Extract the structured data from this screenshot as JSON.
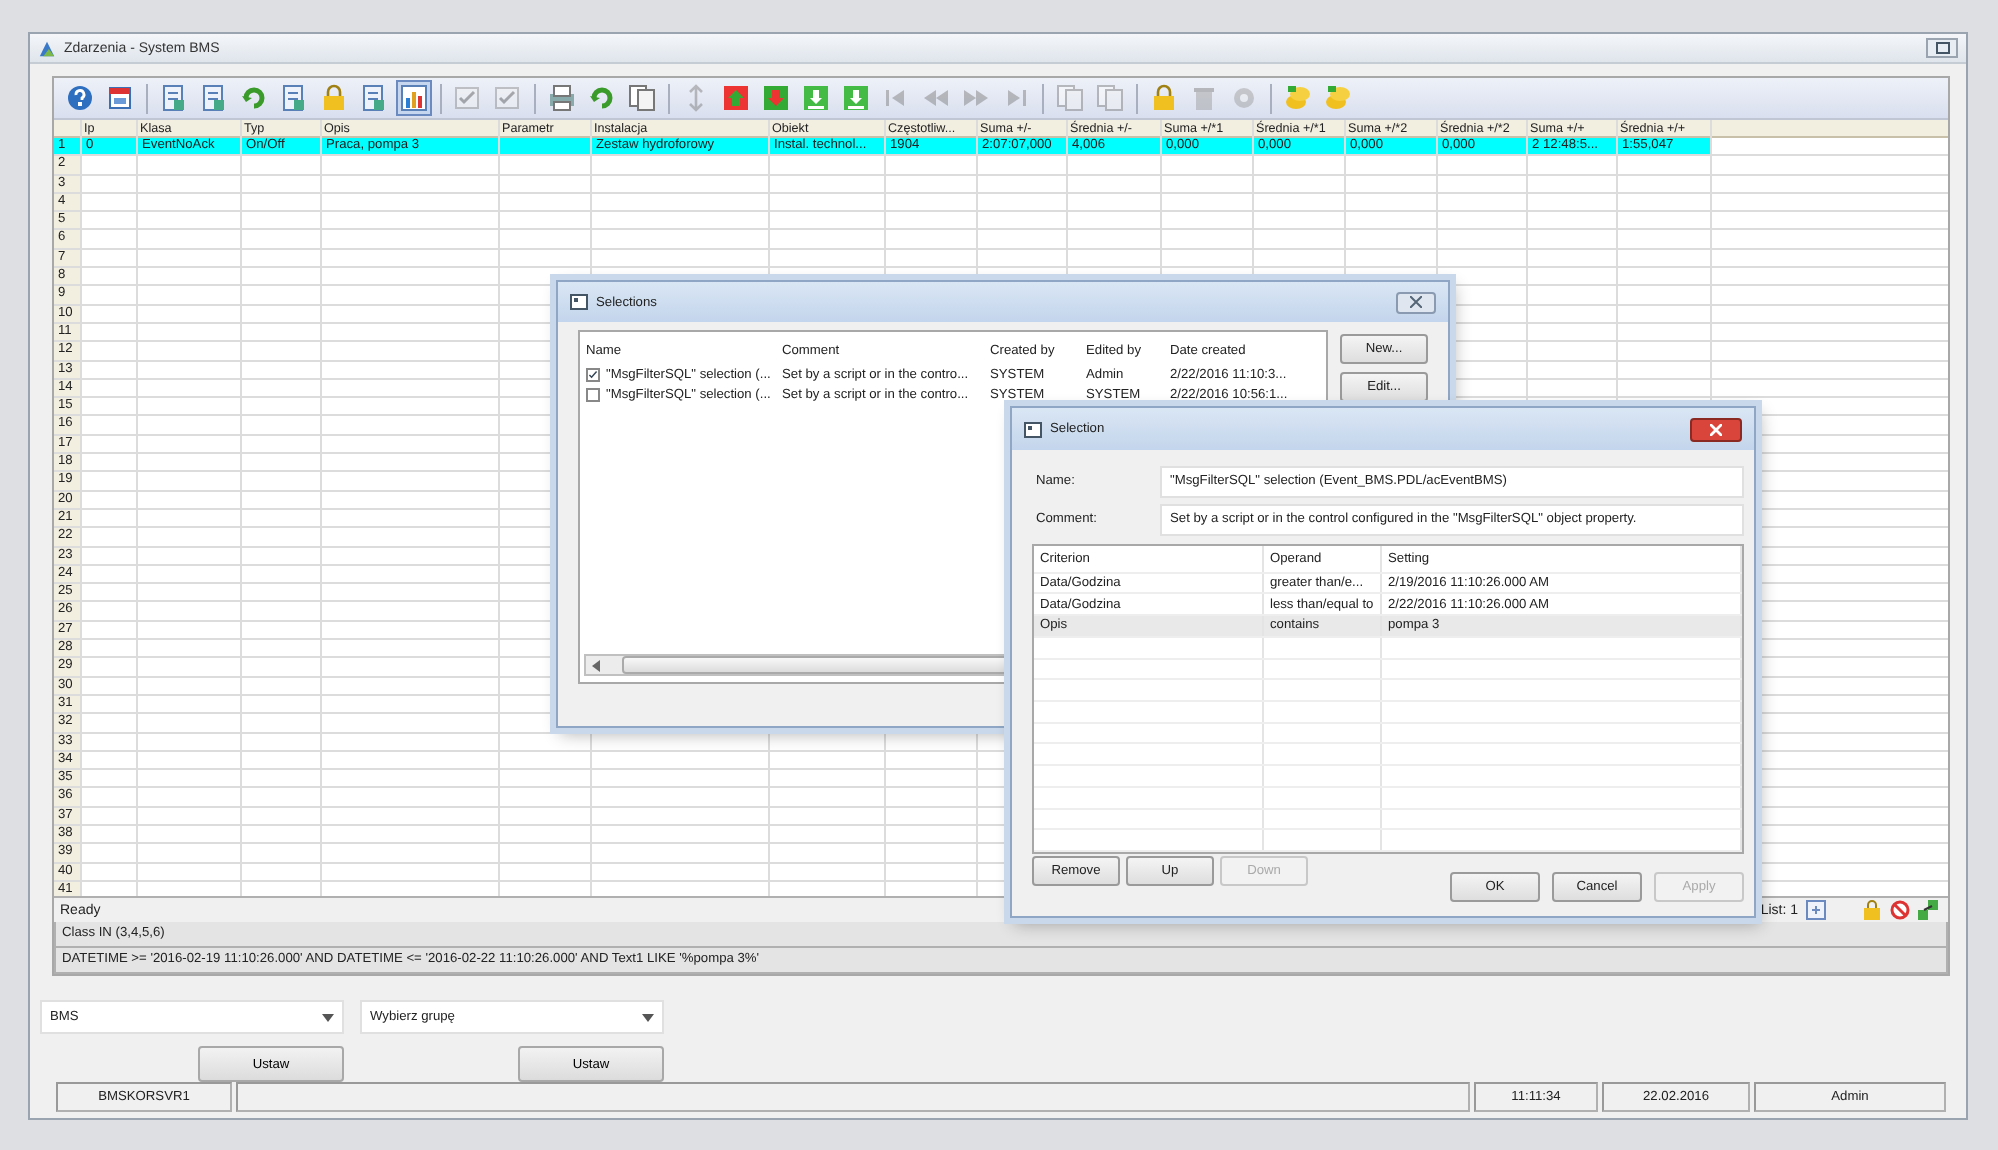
{
  "window": {
    "title": "Zdarzenia - System BMS"
  },
  "toolbar": [
    {
      "kind": "help",
      "disabled": false,
      "pressed": false
    },
    {
      "kind": "calendar",
      "disabled": false,
      "pressed": false
    },
    {
      "kind": "separator"
    },
    {
      "kind": "document",
      "disabled": false,
      "pressed": false
    },
    {
      "kind": "document",
      "disabled": false,
      "pressed": false
    },
    {
      "kind": "refresh",
      "disabled": false,
      "pressed": false
    },
    {
      "kind": "document",
      "disabled": false,
      "pressed": false
    },
    {
      "kind": "lock",
      "disabled": false,
      "pressed": false
    },
    {
      "kind": "document",
      "disabled": false,
      "pressed": false
    },
    {
      "kind": "chart",
      "disabled": false,
      "pressed": true
    },
    {
      "kind": "separator"
    },
    {
      "kind": "check",
      "disabled": true,
      "pressed": false
    },
    {
      "kind": "check",
      "disabled": true,
      "pressed": false
    },
    {
      "kind": "separator"
    },
    {
      "kind": "printer",
      "disabled": false,
      "pressed": false
    },
    {
      "kind": "refresh",
      "disabled": false,
      "pressed": false
    },
    {
      "kind": "copy",
      "disabled": false,
      "pressed": false
    },
    {
      "kind": "separator"
    },
    {
      "kind": "pin",
      "disabled": true,
      "pressed": false
    },
    {
      "kind": "arrow-up",
      "disabled": false,
      "pressed": false
    },
    {
      "kind": "arrow-down",
      "disabled": false,
      "pressed": false
    },
    {
      "kind": "download",
      "disabled": false,
      "pressed": false
    },
    {
      "kind": "download",
      "disabled": false,
      "pressed": false
    },
    {
      "kind": "first",
      "disabled": true,
      "pressed": false
    },
    {
      "kind": "prev",
      "disabled": true,
      "pressed": false
    },
    {
      "kind": "next",
      "disabled": true,
      "pressed": false
    },
    {
      "kind": "last",
      "disabled": true,
      "pressed": false
    },
    {
      "kind": "separator"
    },
    {
      "kind": "copy",
      "disabled": true,
      "pressed": false
    },
    {
      "kind": "copy",
      "disabled": true,
      "pressed": false
    },
    {
      "kind": "separator"
    },
    {
      "kind": "lock",
      "disabled": false,
      "pressed": false
    },
    {
      "kind": "trash",
      "disabled": true,
      "pressed": false
    },
    {
      "kind": "gear",
      "disabled": true,
      "pressed": false
    },
    {
      "kind": "separator"
    },
    {
      "kind": "coins",
      "disabled": false,
      "pressed": false
    },
    {
      "kind": "coins",
      "disabled": false,
      "pressed": false
    }
  ],
  "table": {
    "columns": [
      "Ip",
      "Klasa",
      "Typ",
      "Opis",
      "Parametr",
      "Instalacja",
      "Obiekt",
      "Częstotliw...",
      "Suma +/-",
      "Średnia +/-",
      "Suma +/*1",
      "Średnia +/*1",
      "Suma +/*2",
      "Średnia +/*2",
      "Suma +/+",
      "Średnia +/+"
    ],
    "rows": [
      {
        "number": "1",
        "selected": true,
        "cells": [
          "0",
          "EventNoAck",
          "On/Off",
          "Praca, pompa 3",
          null,
          "Zestaw hydroforowy",
          "Instal. technol...",
          "1904",
          "2:07:07,000",
          "4,006",
          "0,000",
          "0,000",
          "0,000",
          "0,000",
          "2 12:48:5...",
          "1:55,047"
        ]
      },
      {
        "number": "2",
        "selected": false
      },
      {
        "number": "3",
        "selected": false
      },
      {
        "number": "4",
        "selected": false
      },
      {
        "number": "5",
        "selected": false
      },
      {
        "number": "6",
        "selected": false
      },
      {
        "number": "7",
        "selected": false
      },
      {
        "number": "8",
        "selected": false
      },
      {
        "number": "9",
        "selected": false
      },
      {
        "number": "10",
        "selected": false
      },
      {
        "number": "11",
        "selected": false
      },
      {
        "number": "12",
        "selected": false
      },
      {
        "number": "13",
        "selected": false
      },
      {
        "number": "14",
        "selected": false
      },
      {
        "number": "15",
        "selected": false
      },
      {
        "number": "16",
        "selected": false
      },
      {
        "number": "17",
        "selected": false
      },
      {
        "number": "18",
        "selected": false
      },
      {
        "number": "19",
        "selected": false
      },
      {
        "number": "20",
        "selected": false
      },
      {
        "number": "21",
        "selected": false
      },
      {
        "number": "22",
        "selected": false
      },
      {
        "number": "23",
        "selected": false
      },
      {
        "number": "24",
        "selected": false
      },
      {
        "number": "25",
        "selected": false
      },
      {
        "number": "26",
        "selected": false
      },
      {
        "number": "27",
        "selected": false
      },
      {
        "number": "28",
        "selected": false
      },
      {
        "number": "29",
        "selected": false
      },
      {
        "number": "30",
        "selected": false
      },
      {
        "number": "31",
        "selected": false
      },
      {
        "number": "32",
        "selected": false
      },
      {
        "number": "33",
        "selected": false
      },
      {
        "number": "34",
        "selected": false
      },
      {
        "number": "35",
        "selected": false
      },
      {
        "number": "36",
        "selected": false
      },
      {
        "number": "37",
        "selected": false
      },
      {
        "number": "38",
        "selected": false
      },
      {
        "number": "39",
        "selected": false
      },
      {
        "number": "40",
        "selected": false
      },
      {
        "number": "41",
        "selected": false
      }
    ]
  },
  "status": {
    "text": "Ready",
    "list": "List: 1"
  },
  "filters": [
    "Class IN (3,4,5,6)",
    "DATETIME >= '2016-02-19 11:10:26.000' AND DATETIME <= '2016-02-22 11:10:26.000' AND Text1 LIKE '%pompa 3%'"
  ],
  "combos": [
    {
      "value": "BMS"
    },
    {
      "value": "Wybierz grupę"
    }
  ],
  "set_buttons": [
    "Ustaw",
    "Ustaw"
  ],
  "status_bar": [
    "BMSKORSVR1",
    "11:11:34",
    "22.02.2016",
    "Admin"
  ],
  "selections_dialog": {
    "title": "Selections",
    "columns": [
      "Name",
      "Comment",
      "Created by",
      "Edited by",
      "Date created"
    ],
    "rows": [
      {
        "checked": true,
        "cells": [
          "\"MsgFilterSQL\" selection (...",
          "Set by a script or in the contro...",
          "SYSTEM",
          "Admin",
          "2/22/2016 11:10:3..."
        ]
      },
      {
        "checked": false,
        "cells": [
          "\"MsgFilterSQL\" selection (...",
          "Set by a script or in the contro...",
          "SYSTEM",
          "SYSTEM",
          "2/22/2016 10:56:1..."
        ]
      }
    ],
    "buttons": [
      "New...",
      "Edit..."
    ]
  },
  "selection_dialog": {
    "title": "Selection",
    "name_label": "Name:",
    "name_value": "\"MsgFilterSQL\" selection (Event_BMS.PDL/acEventBMS)",
    "comment_label": "Comment:",
    "comment_value": "Set by a script or in the control configured in the \"MsgFilterSQL\" object property.",
    "columns": [
      "Criterion",
      "Operand",
      "Setting"
    ],
    "rows": [
      {
        "selected": false,
        "cells": [
          "Data/Godzina",
          "greater than/e...",
          "2/19/2016 11:10:26.000 AM"
        ]
      },
      {
        "selected": false,
        "cells": [
          "Data/Godzina",
          "less than/equal to",
          "2/22/2016 11:10:26.000 AM"
        ]
      },
      {
        "selected": true,
        "cells": [
          "Opis",
          "contains",
          "pompa 3"
        ]
      }
    ],
    "left_buttons": [
      {
        "label": "Remove",
        "disabled": false
      },
      {
        "label": "Up",
        "disabled": false
      },
      {
        "label": "Down",
        "disabled": true
      }
    ],
    "right_buttons": [
      {
        "label": "OK",
        "disabled": false
      },
      {
        "label": "Cancel",
        "disabled": false
      },
      {
        "label": "Apply",
        "disabled": true
      }
    ]
  }
}
